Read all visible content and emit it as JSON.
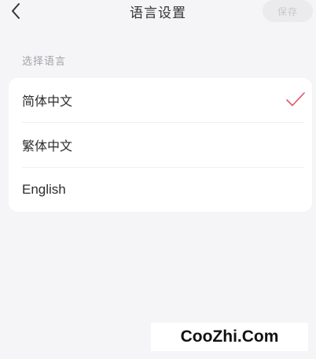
{
  "header": {
    "title": "语言设置",
    "save_label": "保存"
  },
  "section": {
    "label": "选择语言"
  },
  "languages": [
    {
      "label": "简体中文",
      "selected": true
    },
    {
      "label": "繁体中文",
      "selected": false
    },
    {
      "label": "English",
      "selected": false
    }
  ],
  "colors": {
    "accent": "#e0566a",
    "background": "#f5f5f7",
    "card": "#ffffff"
  },
  "icons": {
    "back": "chevron-left-icon",
    "check": "checkmark-icon"
  },
  "watermark": {
    "text": "CooZhi.Com"
  }
}
